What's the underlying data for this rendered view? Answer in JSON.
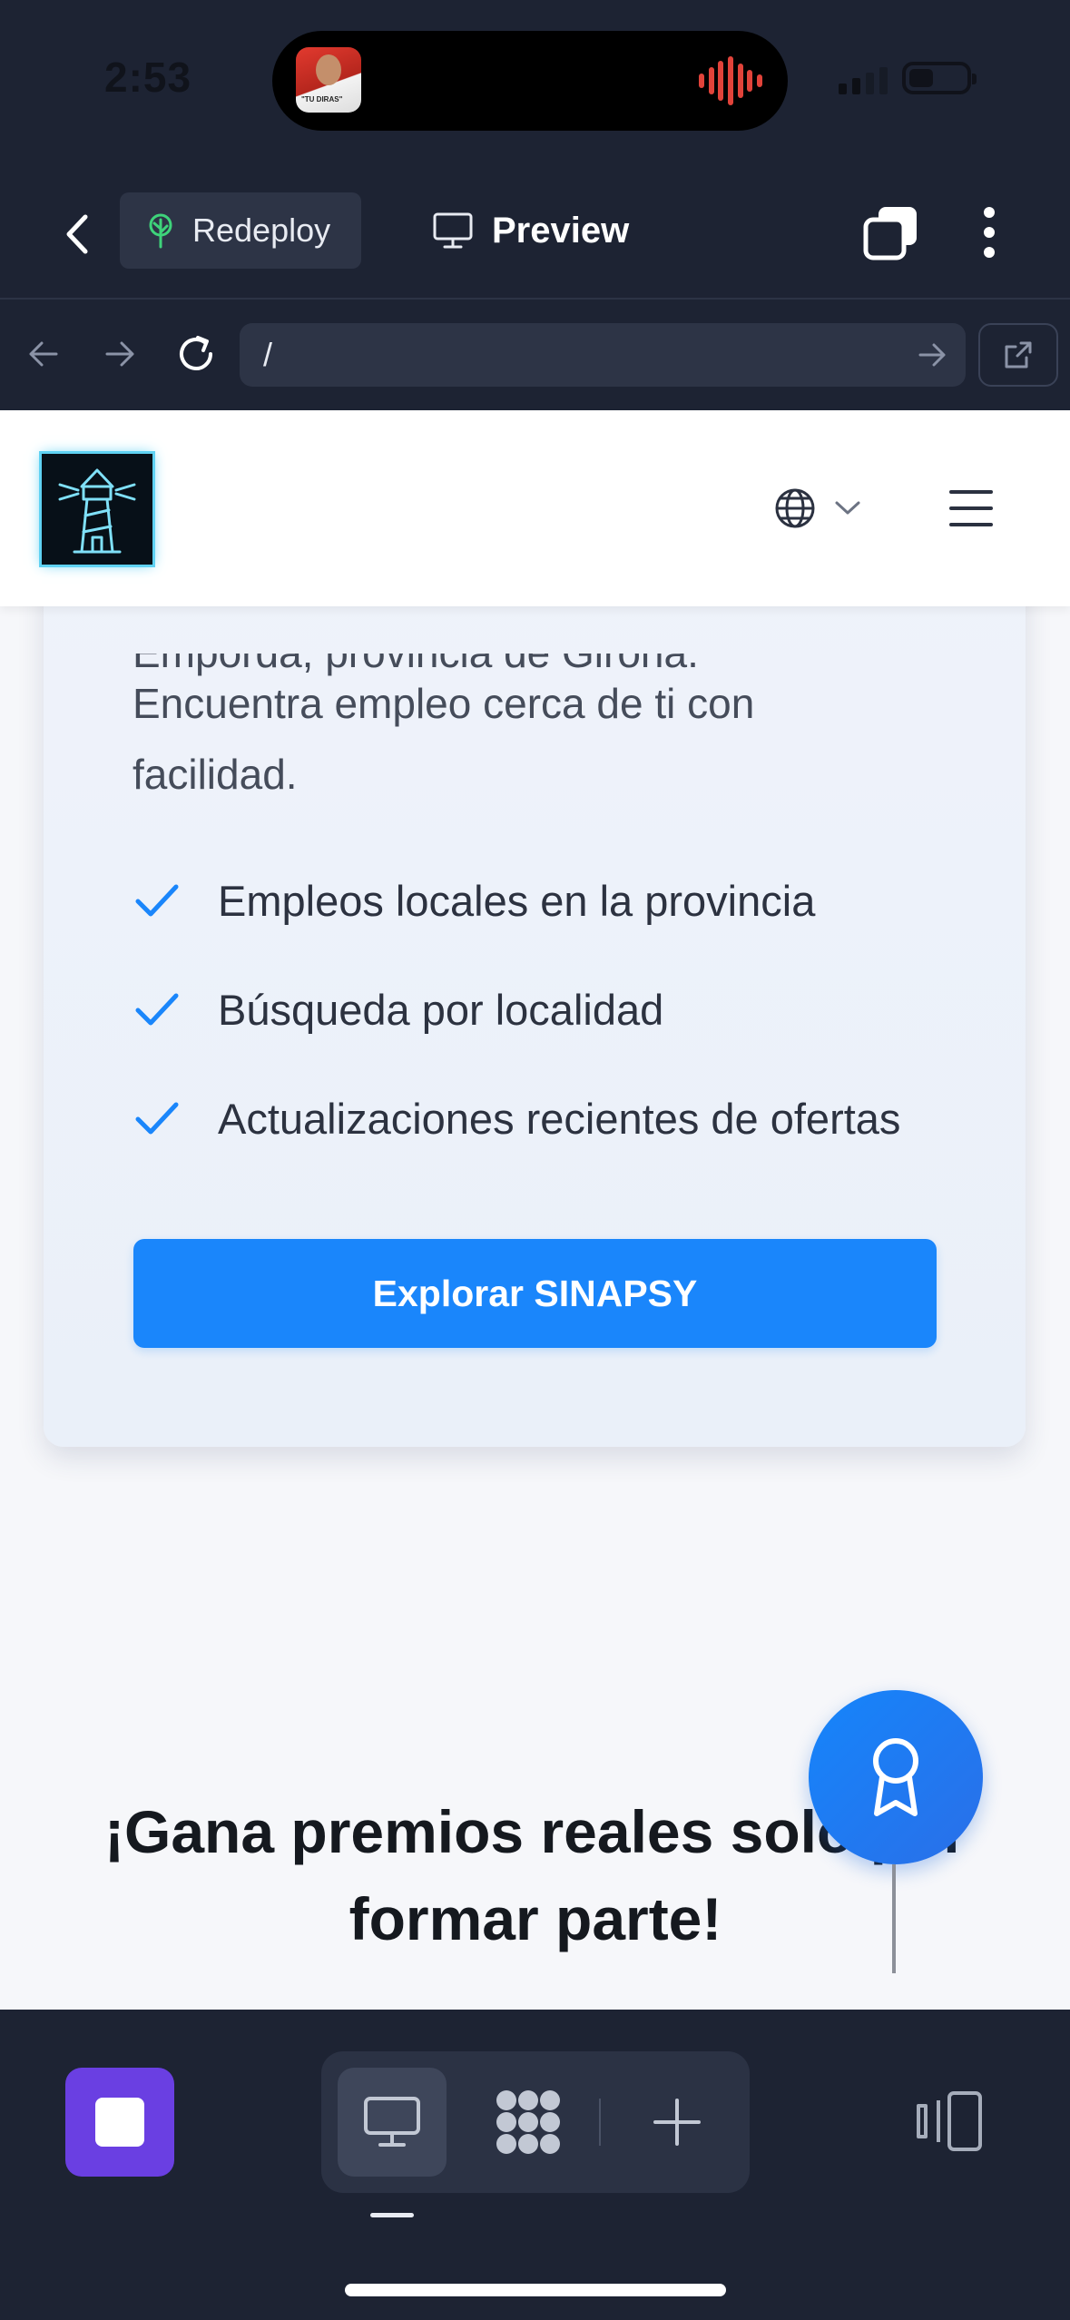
{
  "status_bar": {
    "time": "2:53",
    "live_activity_caption": "\"TU DIRAS\""
  },
  "toolbar": {
    "redeploy_label": "Redeploy",
    "preview_label": "Preview"
  },
  "browser": {
    "url": "/"
  },
  "site": {
    "card": {
      "partial_line": "Empordà, provincia de Girona.",
      "description_line1": "Encuentra empleo cerca de ti con",
      "description_line2": "facilidad.",
      "features": [
        "Empleos locales en la provincia",
        "Búsqueda por localidad",
        "Actualizaciones recientes de ofertas"
      ],
      "cta_label": "Explorar SINAPSY"
    },
    "section_heading_line1": "¡Gana premios reales solo por",
    "section_heading_line2": "formar parte!"
  },
  "colors": {
    "app_background": "#1d2333",
    "accent_blue": "#1a86fb",
    "stop_button": "#6a3fe2",
    "check_blue": "#1a86fb"
  }
}
